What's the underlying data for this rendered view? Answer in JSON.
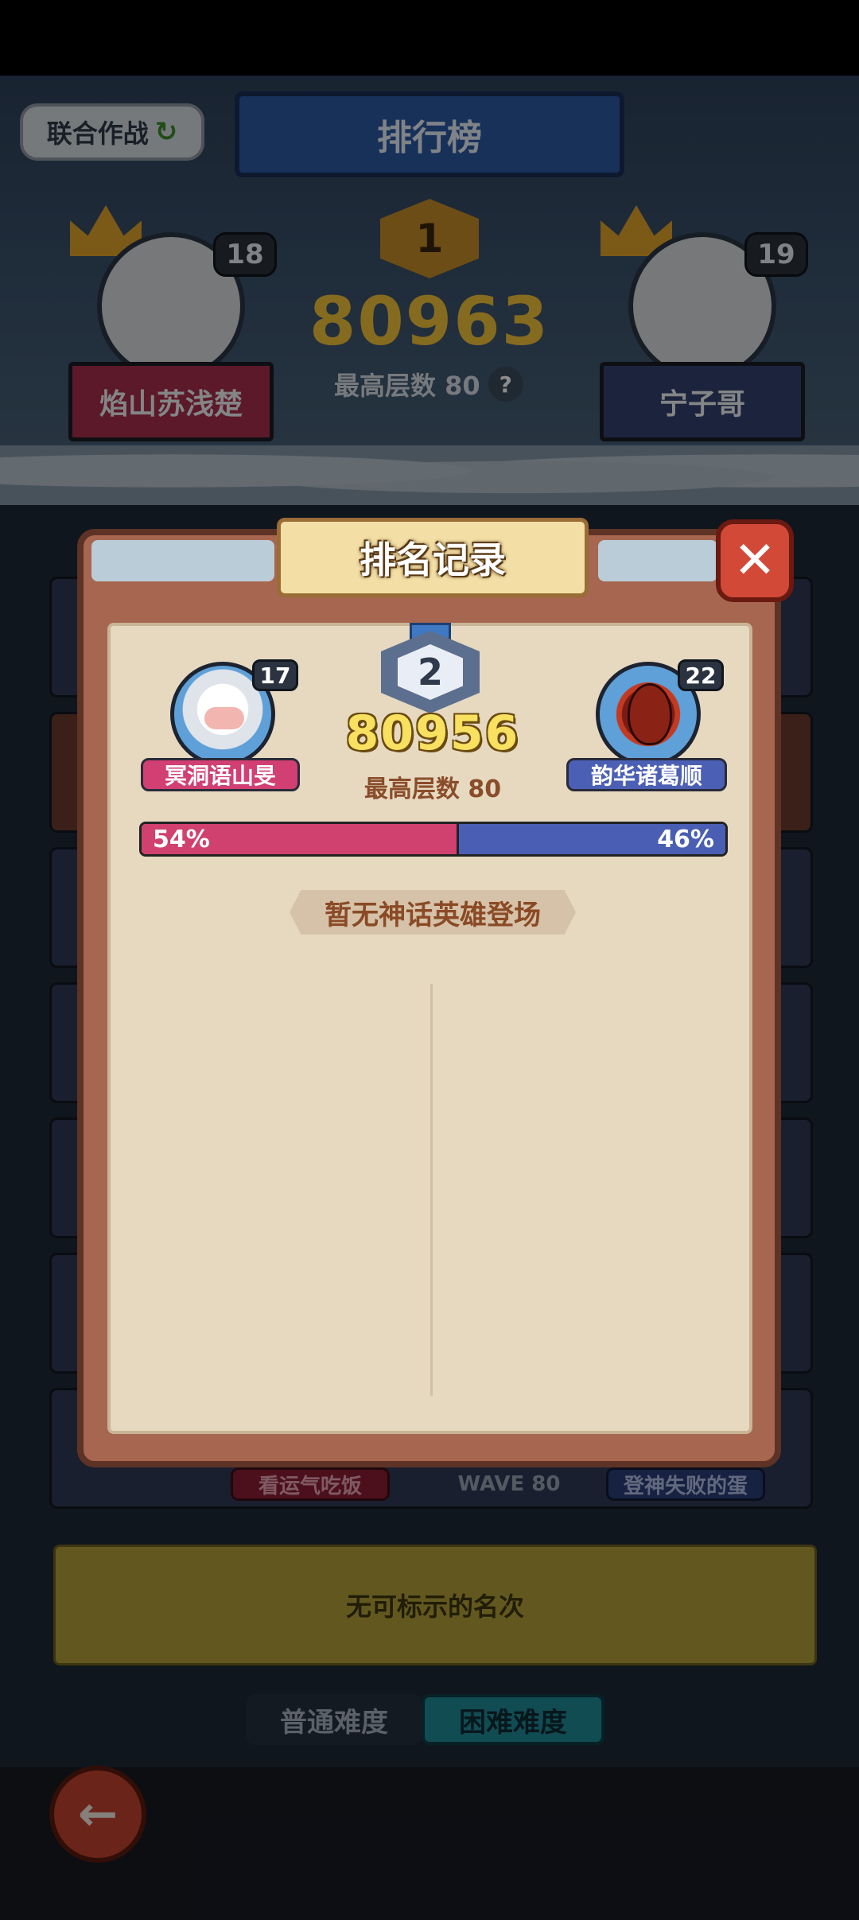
{
  "background": {
    "coop_button": "联合作战",
    "title": "排行榜",
    "first_place": {
      "rank": "1",
      "score": "80963",
      "max_floor_label": "最高层数 80",
      "left_player": {
        "name": "焰山苏浅楚",
        "level": "18"
      },
      "right_player": {
        "name": "宁子哥",
        "level": "19"
      }
    },
    "row_labels": {
      "left": "看运气吃饭",
      "wave": "WAVE 80",
      "right": "登神失败的蛋"
    },
    "no_rank_text": "无可标示的名次",
    "tabs": {
      "normal": "普通难度",
      "hard": "困难难度"
    }
  },
  "modal": {
    "title": "排名记录",
    "close_icon": "close-x",
    "rank": "2",
    "score": "80956",
    "max_floor_label": "最高层数 80",
    "left_player": {
      "name": "冥洞语山旻",
      "level": "17",
      "avatar": "white-beard-wizard"
    },
    "right_player": {
      "name": "韵华诸葛顺",
      "level": "22",
      "avatar": "lava-egg"
    },
    "split": {
      "left_percent": 54,
      "left_label": "54%",
      "right_label": "46%"
    },
    "no_mythic_hero": "暂无神话英雄登场"
  },
  "colors": {
    "team_red": "#d0416f",
    "team_blue": "#4a5fb3",
    "score_yellow": "#f8e060"
  }
}
